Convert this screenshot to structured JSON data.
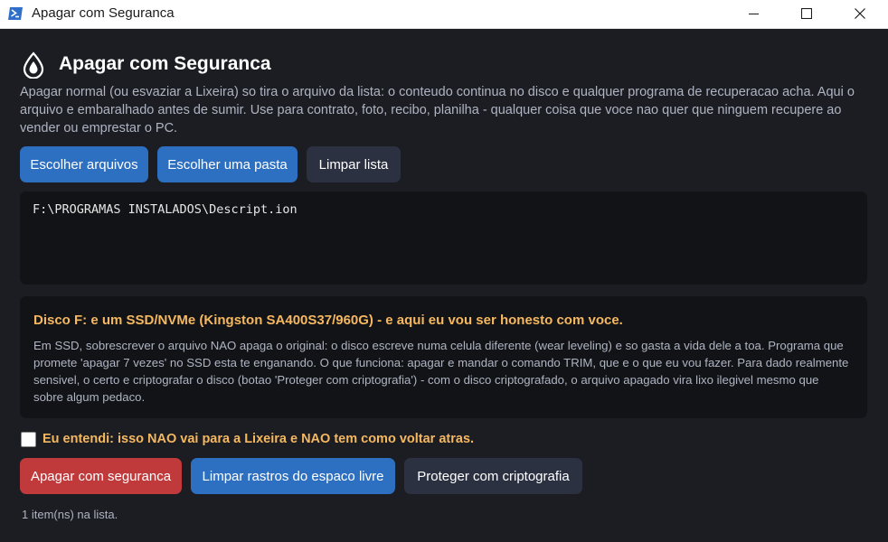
{
  "window": {
    "title": "Apagar com Seguranca"
  },
  "header": {
    "title": "Apagar com Seguranca",
    "description": "Apagar normal (ou esvaziar a Lixeira) so tira o arquivo da lista: o conteudo continua no disco e qualquer programa de recuperacao acha. Aqui o arquivo e embaralhado antes de sumir. Use para contrato, foto, recibo, planilha - qualquer coisa que voce nao quer que ninguem recupere ao vender ou emprestar o PC."
  },
  "toolbar": {
    "choose_files_label": "Escolher arquivos",
    "choose_folder_label": "Escolher uma pasta",
    "clear_list_label": "Limpar lista"
  },
  "file_list": {
    "items": [
      "F:\\PROGRAMAS INSTALADOS\\Descript.ion"
    ]
  },
  "warning": {
    "title": "Disco F: e um SSD/NVMe (Kingston SA400S37/960G) - e aqui eu vou ser honesto com voce.",
    "text": "Em SSD, sobrescrever o arquivo NAO apaga o original: o disco escreve numa celula diferente (wear leveling) e so gasta a vida dele a toa. Programa que promete 'apagar 7 vezes' no SSD esta te enganando. O que funciona: apagar e mandar o comando TRIM, que e o que eu vou fazer. Para dado realmente sensivel, o certo e criptografar o disco (botao 'Proteger com criptografia') - com o disco criptografado, o arquivo apagado vira lixo ilegivel mesmo que sobre algum pedaco."
  },
  "confirm": {
    "label": "Eu entendi: isso NAO vai para a Lixeira e NAO tem como voltar atras.",
    "checked": false
  },
  "actions": {
    "secure_delete_label": "Apagar com seguranca",
    "wipe_free_space_label": "Limpar rastros do espaco livre",
    "encrypt_label": "Proteger com criptografia"
  },
  "status": {
    "text": "1 item(ns) na lista."
  },
  "colors": {
    "background": "#1c1d22",
    "panel": "#121317",
    "primary": "#2d6fc0",
    "danger": "#c0393b",
    "secondary": "#2c3142",
    "warning_accent": "#f5b860"
  }
}
